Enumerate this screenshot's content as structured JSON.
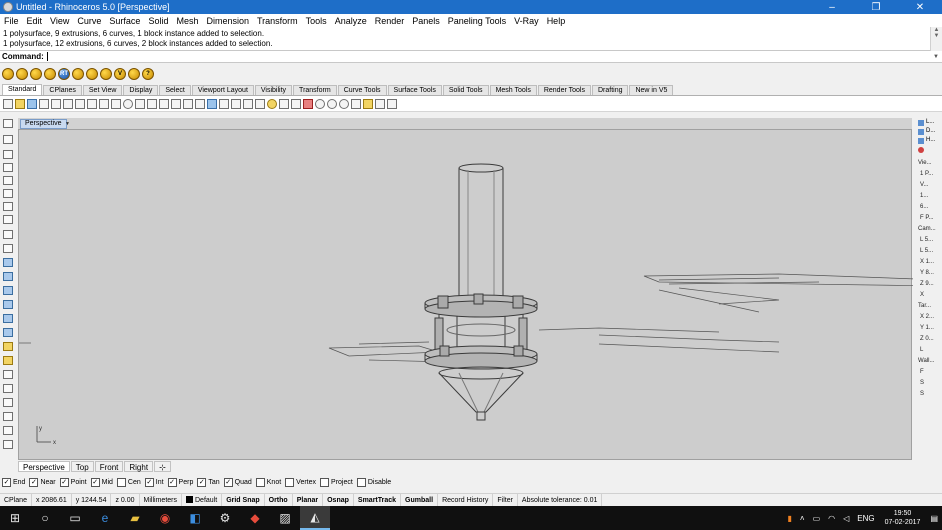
{
  "window": {
    "title": "Untitled - Rhinoceros 5.0 [Perspective]",
    "min": "–",
    "max": "❐",
    "close": "✕"
  },
  "menu": [
    "File",
    "Edit",
    "View",
    "Curve",
    "Surface",
    "Solid",
    "Mesh",
    "Dimension",
    "Transform",
    "Tools",
    "Analyze",
    "Render",
    "Panels",
    "Paneling Tools",
    "V-Ray",
    "Help"
  ],
  "command": {
    "history": [
      "1 polysurface, 9 extrusions, 6 curves, 1 block instance added to selection.",
      "1 polysurface, 12 extrusions, 6 curves, 2 block instances added to selection."
    ],
    "prompt_label": "Command:"
  },
  "quick_icons": [
    "RT",
    "V",
    "?"
  ],
  "toolbar_tabs": [
    "Standard",
    "CPlanes",
    "Set View",
    "Display",
    "Select",
    "Viewport Layout",
    "Visibility",
    "Transform",
    "Curve Tools",
    "Surface Tools",
    "Solid Tools",
    "Mesh Tools",
    "Render Tools",
    "Drafting",
    "New in V5"
  ],
  "viewport": {
    "name": "Perspective",
    "axis_y": "y",
    "axis_x": "x"
  },
  "viewport_tabs": [
    "Perspective",
    "Top",
    "Front",
    "Right",
    "⊹"
  ],
  "osnaps": [
    {
      "label": "End",
      "checked": true
    },
    {
      "label": "Near",
      "checked": true
    },
    {
      "label": "Point",
      "checked": true
    },
    {
      "label": "Mid",
      "checked": true
    },
    {
      "label": "Cen",
      "checked": false
    },
    {
      "label": "Int",
      "checked": true
    },
    {
      "label": "Perp",
      "checked": true
    },
    {
      "label": "Tan",
      "checked": true
    },
    {
      "label": "Quad",
      "checked": true
    },
    {
      "label": "Knot",
      "checked": false
    },
    {
      "label": "Vertex",
      "checked": false
    },
    {
      "label": "Project",
      "checked": false
    },
    {
      "label": "Disable",
      "checked": false
    }
  ],
  "status": {
    "cplane": "CPlane",
    "x": "x 2086.61",
    "y": "y 1244.54",
    "z": "z 0.00",
    "units": "Millimeters",
    "layer": "Default",
    "grid_snap": "Grid Snap",
    "ortho": "Ortho",
    "planar": "Planar",
    "osnap": "Osnap",
    "smarttrack": "SmartTrack",
    "gumball": "Gumball",
    "record": "Record History",
    "filter": "Filter",
    "tolerance": "Absolute tolerance: 0.01"
  },
  "right_panel": {
    "tabs": [
      "L...",
      "D...",
      "H..."
    ],
    "section_view": "Vie...",
    "view_items": [
      "1 P...",
      "V...",
      "1...",
      "6...",
      "F P..."
    ],
    "section_cam": "Cam...",
    "cam_items": [
      "L 5...",
      "L 5...",
      "X 1...",
      "Y 8...",
      "Z 9...",
      "X"
    ],
    "section_target": "Tar...",
    "target_items": [
      "X 2...",
      "Y 1...",
      "Z 0...",
      "L"
    ],
    "section_wall": "Wall...",
    "wall_items": [
      "F",
      "S",
      "S"
    ]
  },
  "taskbar": {
    "lang": "ENG",
    "time": "19:50",
    "date": "07-02-2017"
  }
}
